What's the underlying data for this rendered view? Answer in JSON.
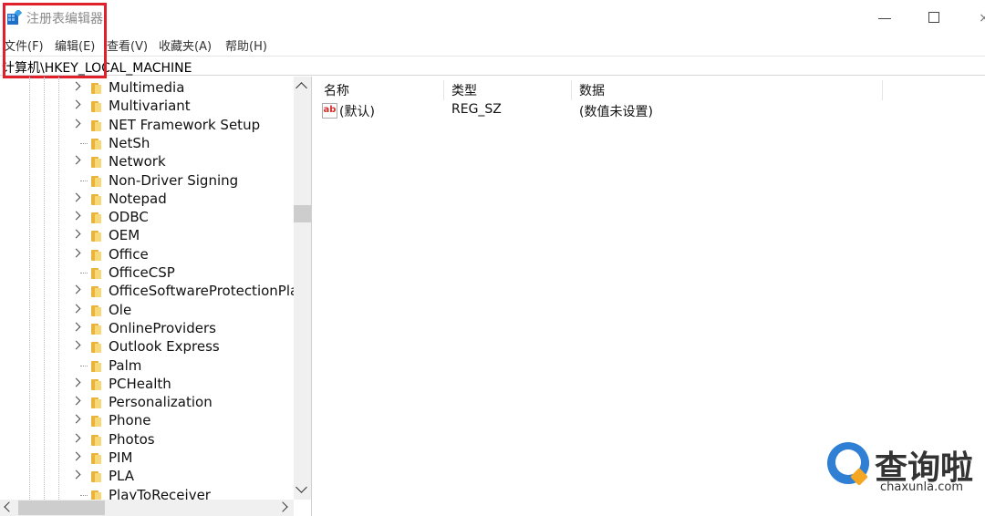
{
  "window": {
    "title": "注册表编辑器",
    "close_glyph": "×"
  },
  "menu": [
    {
      "label": "文件(F)"
    },
    {
      "label": "编辑(E)"
    },
    {
      "label": "查看(V)"
    },
    {
      "label": "收藏夹(A)"
    },
    {
      "label": "帮助(H)"
    }
  ],
  "address": {
    "path": "计算机\\HKEY_LOCAL_MACHINE"
  },
  "tree": {
    "items": [
      {
        "label": "Multimedia",
        "expandable": true
      },
      {
        "label": "Multivariant",
        "expandable": true
      },
      {
        "label": "NET Framework Setup",
        "expandable": true
      },
      {
        "label": "NetSh",
        "expandable": false
      },
      {
        "label": "Network",
        "expandable": true
      },
      {
        "label": "Non-Driver Signing",
        "expandable": false
      },
      {
        "label": "Notepad",
        "expandable": true
      },
      {
        "label": "ODBC",
        "expandable": true
      },
      {
        "label": "OEM",
        "expandable": true
      },
      {
        "label": "Office",
        "expandable": true
      },
      {
        "label": "OfficeCSP",
        "expandable": false
      },
      {
        "label": "OfficeSoftwareProtectionPlatfo",
        "expandable": true
      },
      {
        "label": "Ole",
        "expandable": true
      },
      {
        "label": "OnlineProviders",
        "expandable": true
      },
      {
        "label": "Outlook Express",
        "expandable": true
      },
      {
        "label": "Palm",
        "expandable": false
      },
      {
        "label": "PCHealth",
        "expandable": true
      },
      {
        "label": "Personalization",
        "expandable": true
      },
      {
        "label": "Phone",
        "expandable": true
      },
      {
        "label": "Photos",
        "expandable": true
      },
      {
        "label": "PIM",
        "expandable": true
      },
      {
        "label": "PLA",
        "expandable": true
      },
      {
        "label": "PlayToReceiver",
        "expandable": false
      }
    ]
  },
  "list": {
    "columns": [
      "名称",
      "类型",
      "数据"
    ],
    "rows": [
      {
        "name": "(默认)",
        "type": "REG_SZ",
        "data": "(数值未设置)",
        "icon": "ab"
      }
    ]
  },
  "watermark": {
    "text": "查询啦",
    "url": "chaxunla.com"
  },
  "colors": {
    "highlight_border": "#e0202a",
    "folder": "#e9b43b",
    "watermark_blue": "#2f7fd4",
    "watermark_orange": "#f5a623"
  }
}
